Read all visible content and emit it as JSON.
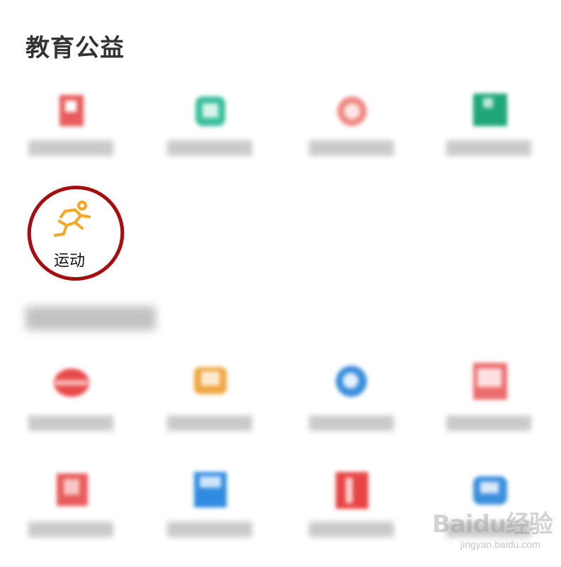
{
  "section_title": "教育公益",
  "highlighted_item": {
    "label": "运动",
    "icon": "running-person-icon",
    "color": "#f5a623"
  },
  "annotation_color": "#a50e0e",
  "top_grid": [
    {
      "icon": "blurred-red-icon",
      "color": "#e85c5c"
    },
    {
      "icon": "blurred-teal-icon",
      "color": "#3cbf9e"
    },
    {
      "icon": "blurred-pink-icon",
      "color": "#ef8a86"
    },
    {
      "icon": "blurred-green-icon",
      "color": "#1ea67a"
    }
  ],
  "bottom_grid": [
    {
      "icon": "blurred-red-icon",
      "color": "#e84a4a"
    },
    {
      "icon": "blurred-orange-icon",
      "color": "#f0a640"
    },
    {
      "icon": "blurred-blue-icon",
      "color": "#3b8fdc"
    },
    {
      "icon": "blurred-salmon-icon",
      "color": "#ec6d6d"
    },
    {
      "icon": "blurred-red-icon",
      "color": "#e85c5c"
    },
    {
      "icon": "blurred-blue-icon",
      "color": "#2f8be0"
    },
    {
      "icon": "blurred-red-icon",
      "color": "#e84444"
    },
    {
      "icon": "blurred-blue-icon",
      "color": "#3b8fdc"
    }
  ],
  "watermark": {
    "text": "Baidu经验",
    "url": "jingyan.baidu.com"
  }
}
